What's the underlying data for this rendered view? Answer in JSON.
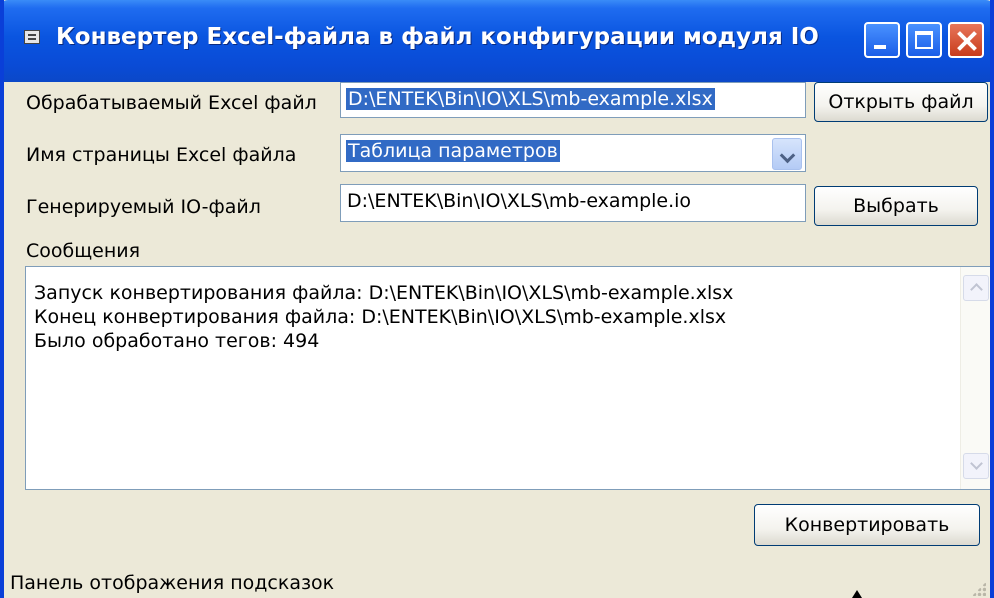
{
  "window": {
    "title": "Конвертер Excel-файла в файл конфигурации модуля IO",
    "icon": "app-icon",
    "controls": [
      "minimize-icon",
      "maximize-icon",
      "close-icon"
    ]
  },
  "form": {
    "excel_file": {
      "label": "Обрабатываемый Excel файл",
      "value": "D:\\ENTEK\\Bin\\IO\\XLS\\mb-example.xlsx",
      "button_label": "Открыть файл"
    },
    "sheet": {
      "label": "Имя страницы Excel файла",
      "value": "Таблица параметров"
    },
    "io_file": {
      "label": "Генерируемый IO-файл",
      "value": "D:\\ENTEK\\Bin\\IO\\XLS\\mb-example.io",
      "button_label": "Выбрать"
    }
  },
  "messages": {
    "label": "Сообщения",
    "lines": [
      "Запуск конвертирования файла: D:\\ENTEK\\Bin\\IO\\XLS\\mb-example.xlsx",
      "Конец конвертирования файла: D:\\ENTEK\\Bin\\IO\\XLS\\mb-example.xlsx",
      "Было обработано тегов: 494"
    ]
  },
  "convert_button_label": "Конвертировать",
  "status_text": "Панель отображения подсказок",
  "colors": {
    "titlebar": "#0a55e0",
    "selection": "#316ac5",
    "window_bg": "#ece9d8"
  }
}
